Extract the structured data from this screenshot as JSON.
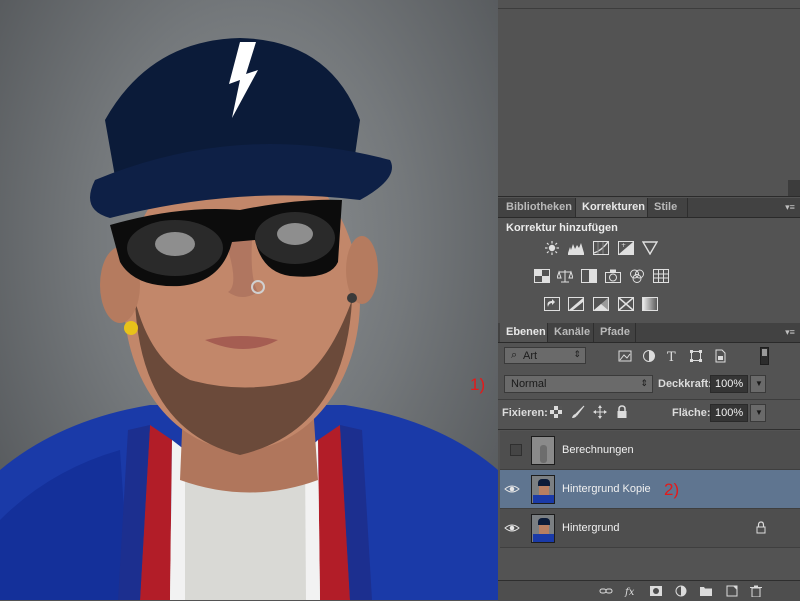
{
  "panel_tabs_top": [
    {
      "label": "Bibliotheken",
      "active": false
    },
    {
      "label": "Korrekturen",
      "active": true
    },
    {
      "label": "Stile",
      "active": false
    }
  ],
  "corrections": {
    "title": "Korrektur hinzufügen",
    "row1": [
      "brightness-contrast-icon",
      "levels-icon",
      "curves-icon",
      "exposure-icon",
      "vibrance-icon"
    ],
    "row2": [
      "hue-saturation-icon",
      "color-balance-icon",
      "black-white-icon",
      "photo-filter-icon",
      "channel-mixer-icon",
      "color-lookup-icon"
    ],
    "row3": [
      "invert-icon",
      "posterize-icon",
      "threshold-icon",
      "selective-color-icon",
      "gradient-map-icon"
    ]
  },
  "layers_tabs": [
    {
      "label": "Ebenen",
      "active": true
    },
    {
      "label": "Kanäle",
      "active": false
    },
    {
      "label": "Pfade",
      "active": false
    }
  ],
  "filter": {
    "label": "Art"
  },
  "blend": {
    "mode": "Normal",
    "opacity_label": "Deckkraft:",
    "opacity": "100%"
  },
  "lock_row": {
    "label": "Fixieren:",
    "fill_label": "Fläche:",
    "fill": "100%"
  },
  "layers": [
    {
      "name": "Berechnungen",
      "visible": false,
      "selected": false,
      "locked": false
    },
    {
      "name": "Hintergrund Kopie",
      "visible": true,
      "selected": true,
      "locked": false
    },
    {
      "name": "Hintergrund",
      "visible": true,
      "selected": false,
      "locked": true
    }
  ],
  "annotations": {
    "one": "1)",
    "two": "2)"
  },
  "colors": {
    "selected_row": "#5f7590",
    "annotation": "#e41a1a",
    "panel": "#535353"
  }
}
